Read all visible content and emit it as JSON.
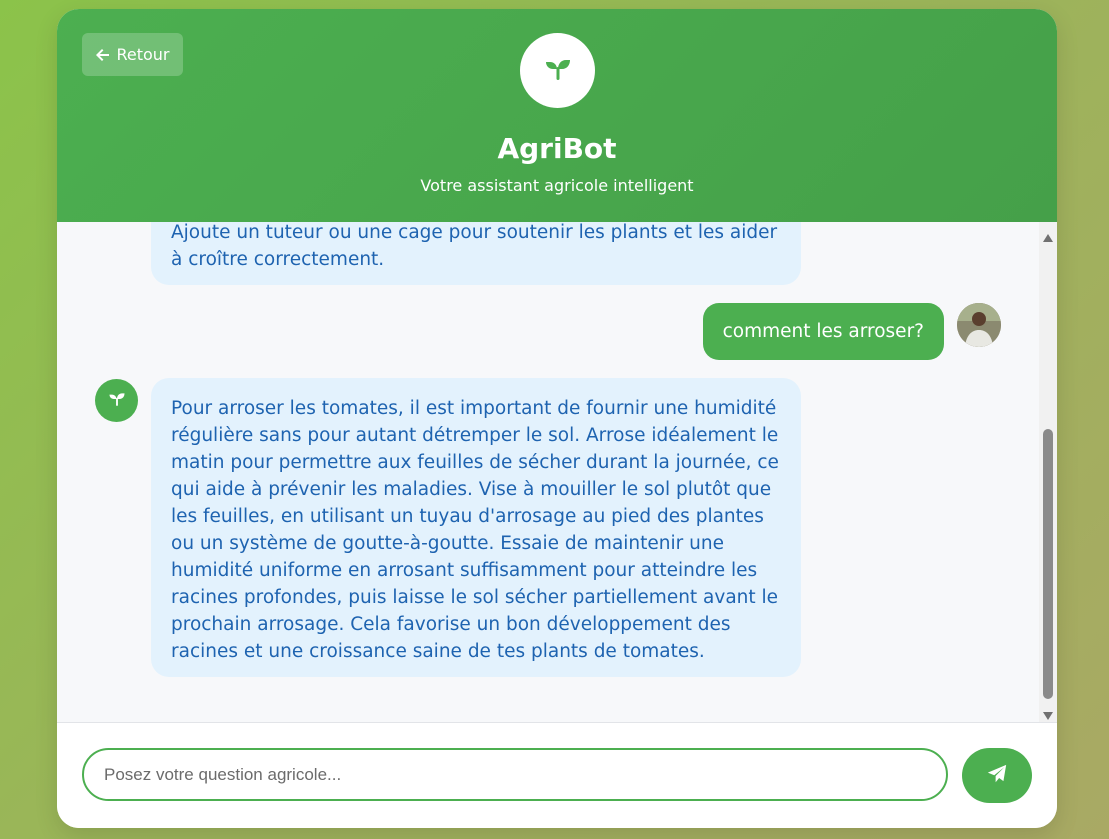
{
  "header": {
    "back_label": "Retour",
    "title": "AgriBot",
    "subtitle": "Votre assistant agricole intelligent"
  },
  "messages": [
    {
      "role": "bot",
      "text": "Ajoute un tuteur ou une cage pour soutenir les plants et les aider à croître correctement."
    },
    {
      "role": "user",
      "text": "comment les arroser?"
    },
    {
      "role": "bot",
      "text": "Pour arroser les tomates, il est important de fournir une humidité régulière sans pour autant détremper le sol. Arrose idéalement le matin pour permettre aux feuilles de sécher durant la journée, ce qui aide à prévenir les maladies. Vise à mouiller le sol plutôt que les feuilles, en utilisant un tuyau d'arrosage au pied des plantes ou un système de goutte-à-goutte. Essaie de maintenir une humidité uniforme en arrosant suffisamment pour atteindre les racines profondes, puis laisse le sol sécher partiellement avant le prochain arrosage. Cela favorise un bon développement des racines et une croissance saine de tes plants de tomates."
    }
  ],
  "input": {
    "placeholder": "Posez votre question agricole...",
    "value": ""
  },
  "icons": {
    "back": "arrow-left-icon",
    "logo": "seedling-icon",
    "bot_avatar": "seedling-icon",
    "send": "paper-plane-icon"
  },
  "colors": {
    "primary": "#4caf50",
    "bot_bubble_bg": "#e3f2fd",
    "bot_bubble_text": "#1e63b0",
    "page_bg": "#8bc34a"
  }
}
